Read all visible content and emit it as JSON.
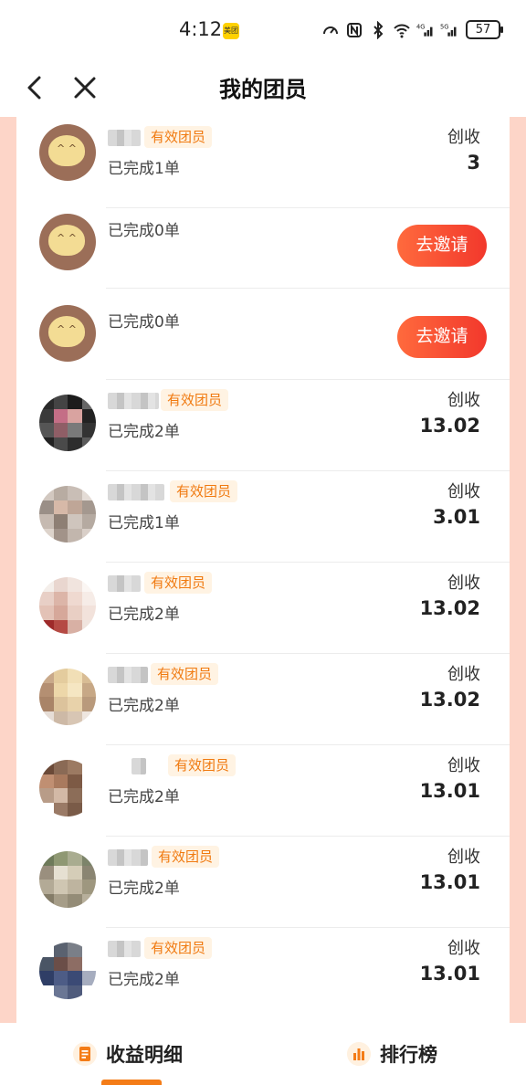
{
  "status_bar": {
    "time": "4:12",
    "app_badge": "美团",
    "battery": "57"
  },
  "header": {
    "title": "我的团员"
  },
  "members": [
    {
      "tag": "有效团员",
      "orders": "已完成1单",
      "earn_label": "创收",
      "earn_value": "3",
      "invite_label": ""
    },
    {
      "tag": "",
      "orders": "已完成0单",
      "earn_label": "",
      "earn_value": "",
      "invite_label": "去邀请"
    },
    {
      "tag": "",
      "orders": "已完成0单",
      "earn_label": "",
      "earn_value": "",
      "invite_label": "去邀请"
    },
    {
      "tag": "有效团员",
      "orders": "已完成2单",
      "earn_label": "创收",
      "earn_value": "13.02",
      "invite_label": ""
    },
    {
      "tag": "有效团员",
      "orders": "已完成1单",
      "earn_label": "创收",
      "earn_value": "3.01",
      "invite_label": ""
    },
    {
      "tag": "有效团员",
      "orders": "已完成2单",
      "earn_label": "创收",
      "earn_value": "13.02",
      "invite_label": ""
    },
    {
      "tag": "有效团员",
      "orders": "已完成2单",
      "earn_label": "创收",
      "earn_value": "13.02",
      "invite_label": ""
    },
    {
      "tag": "有效团员",
      "orders": "已完成2单",
      "earn_label": "创收",
      "earn_value": "13.01",
      "invite_label": ""
    },
    {
      "tag": "有效团员",
      "orders": "已完成2单",
      "earn_label": "创收",
      "earn_value": "13.01",
      "invite_label": ""
    },
    {
      "tag": "有效团员",
      "orders": "已完成2单",
      "earn_label": "创收",
      "earn_value": "13.01",
      "invite_label": ""
    }
  ],
  "bottom_nav": {
    "earnings_label": "收益明细",
    "rank_label": "排行榜",
    "active": "earnings"
  },
  "colors": {
    "accent": "#f47c17",
    "invite": "#f2382c",
    "side_background": "#fdd5c8",
    "tag_text": "#f07a10"
  }
}
